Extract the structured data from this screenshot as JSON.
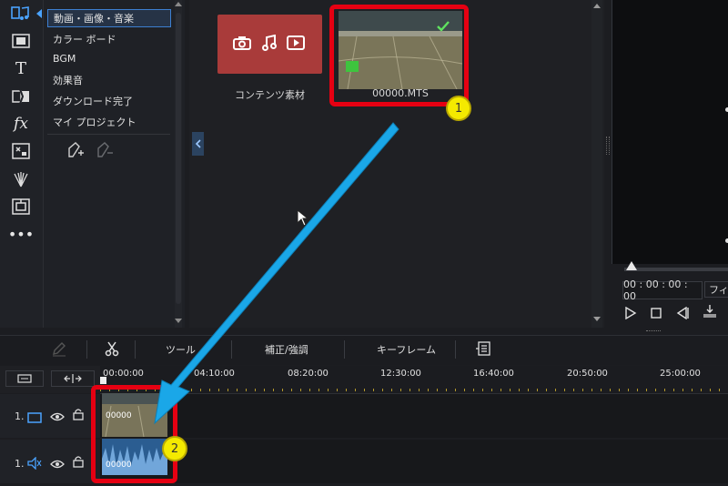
{
  "menu": {
    "items": [
      {
        "label": "動画・画像・音楽",
        "selected": true
      },
      {
        "label": "カラー ボード"
      },
      {
        "label": "BGM"
      },
      {
        "label": "効果音"
      },
      {
        "label": "ダウンロード完了"
      },
      {
        "label": "マイ プロジェクト"
      }
    ]
  },
  "media": {
    "content_tile_label": "コンテンツ素材",
    "video_tile_label": "00000.MTS",
    "badge_1": "1",
    "badge_2": "2"
  },
  "preview": {
    "timecode": "00 : 00 : 00 : 00",
    "fit_label": "フィ"
  },
  "toolbar": {
    "tools_label": "ツール",
    "correction_label": "補正/強調",
    "keyframe_label": "キーフレーム"
  },
  "timeline": {
    "ticks": [
      "00:00:00",
      "04:10:00",
      "08:20:00",
      "12:30:00",
      "16:40:00",
      "20:50:00",
      "25:00:00"
    ],
    "video_track_label": "1.",
    "audio_track_label": "1.",
    "clip_video_label": "00000",
    "clip_audio_label": "00000"
  },
  "colors": {
    "accent": "#3d7fd1",
    "highlight_red": "#e60012",
    "badge_yellow": "#f4ea00",
    "arrow_blue": "#1aa7e8",
    "content_tile": "#a93b3a"
  }
}
